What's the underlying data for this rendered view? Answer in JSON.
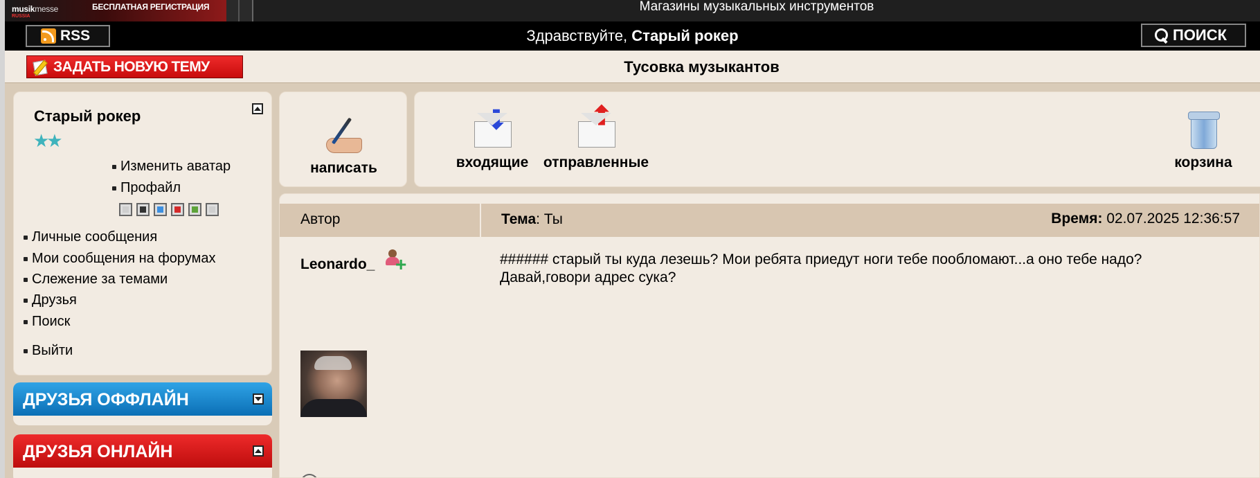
{
  "promo": {
    "brand_bold": "musik",
    "brand_light": "messe",
    "sub": "RUSSIA",
    "text": "БЕСПЛАТНАЯ РЕГИСТРАЦИЯ"
  },
  "top_title": "Магазины музыкальных инструментов",
  "header": {
    "rss_label": "RSS",
    "greeting_prefix": "Здравствуйте, ",
    "greeting_user": "Старый рокер",
    "search_label": "ПОИСК"
  },
  "topic_bar": {
    "new_topic_label": "ЗАДАТЬ НОВУЮ ТЕМУ",
    "forum_title": "Тусовка музыкантов"
  },
  "user_panel": {
    "name": "Старый рокер",
    "stars": "★★",
    "change_avatar": "Изменить аватар",
    "profile": "Профайл",
    "theme_colors": [
      "#cfcfcf",
      "#333333",
      "#3d8fe0",
      "#d42a2a",
      "#5ea33a",
      "#cfcfcf"
    ],
    "menu": [
      "Личные сообщения",
      "Мои сообщения на форумах",
      "Слежение за темами",
      "Друзья",
      "Поиск"
    ],
    "logout": "Выйти"
  },
  "friends_offline": {
    "label": "ДРУЗЬЯ ОФФЛАЙН"
  },
  "friends_online": {
    "label": "ДРУЗЬЯ ОНЛАЙН"
  },
  "toolbar": {
    "write": "написать",
    "inbox": "входящие",
    "sent": "отправленные",
    "trash": "корзина"
  },
  "message": {
    "col_author": "Автор",
    "topic_label": "Тема",
    "topic_value": ": Ты",
    "time_label": "Время:",
    "time_value": " 02.07.2025 12:36:57",
    "author": "Leonardo_",
    "line1": "###### старый ты куда лезешь? Мои ребята приедут ноги тебе пообломают...а оно тебе надо?",
    "line2": "Давай,говори адрес сука?"
  }
}
